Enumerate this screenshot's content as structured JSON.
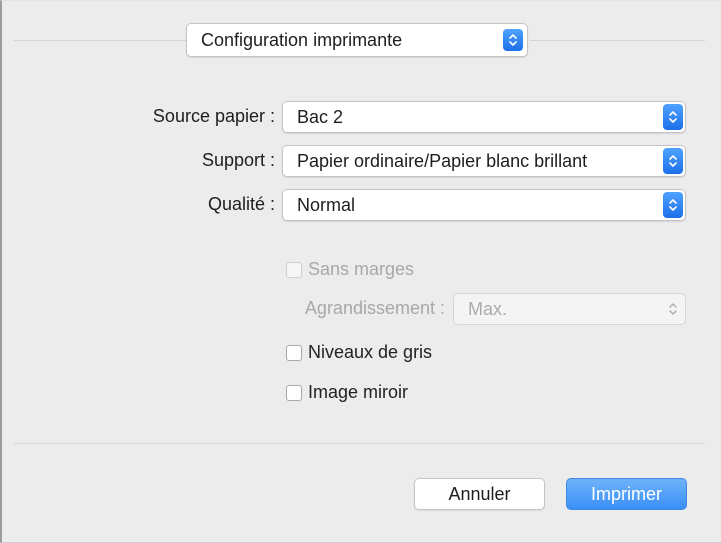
{
  "header": {
    "panel_select": "Configuration imprimante"
  },
  "settings": {
    "source": {
      "label": "Source papier :",
      "value": "Bac 2"
    },
    "support": {
      "label": "Support :",
      "value": "Papier ordinaire/Papier blanc brillant"
    },
    "quality": {
      "label": "Qualité :",
      "value": "Normal"
    }
  },
  "options": {
    "borderless": {
      "label": "Sans marges",
      "checked": false,
      "enabled": false
    },
    "expansion": {
      "label": "Agrandissement :",
      "value": "Max.",
      "enabled": false
    },
    "grayscale": {
      "label": "Niveaux de gris",
      "checked": false
    },
    "mirror": {
      "label": "Image miroir",
      "checked": false
    }
  },
  "footer": {
    "cancel_label": "Annuler",
    "print_label": "Imprimer"
  },
  "colors": {
    "accent": "#3a8ff5",
    "background": "#ececec"
  }
}
